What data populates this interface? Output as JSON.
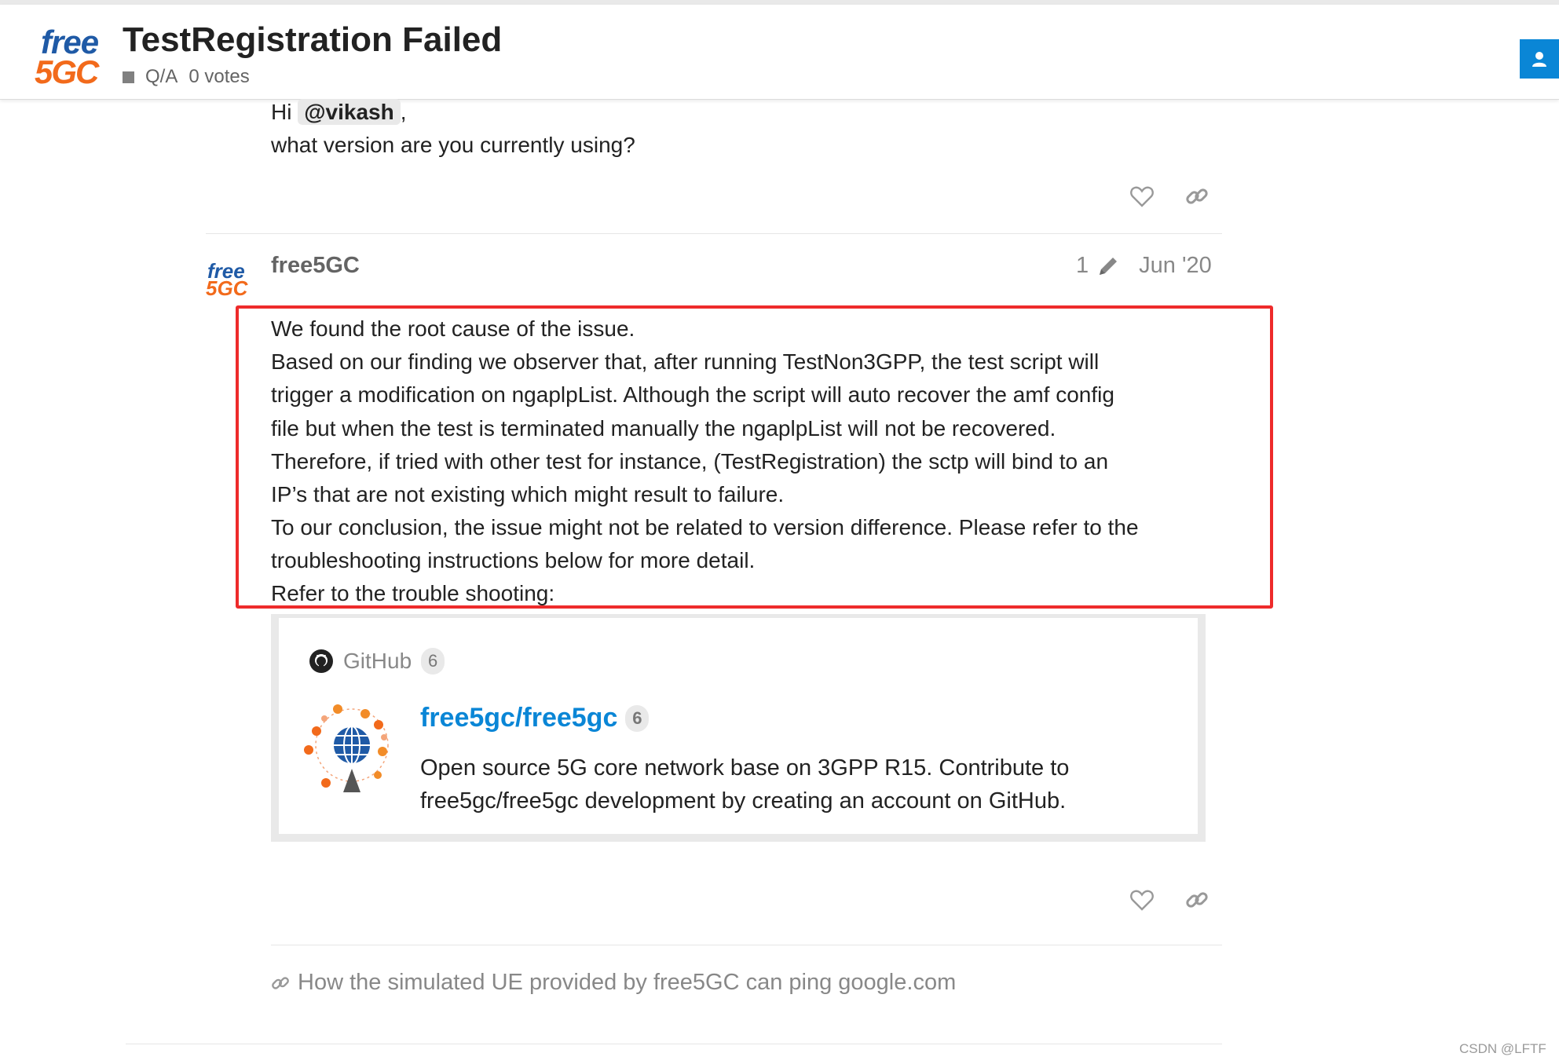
{
  "header": {
    "logo_top": "free",
    "logo_bottom": "5GC",
    "title": "TestRegistration Failed",
    "category": "Q/A",
    "votes": "0 votes"
  },
  "reply_post": {
    "greeting": "Hi",
    "mention": "@vikash",
    "comma": ",",
    "question": "what version are you currently using?"
  },
  "main_post": {
    "avatar_top": "free",
    "avatar_bottom": "5GC",
    "username": "free5GC",
    "edit_count": "1",
    "date": "Jun '20",
    "lines": [
      "We found the root cause of the issue.",
      "Based on our finding we observer that, after running TestNon3GPP, the test script will",
      "trigger a modification on ngaplpList. Although the script will auto recover the amf config",
      "file but when the test is terminated manually the ngaplpList will not be recovered.",
      "Therefore, if tried with other test for instance, (TestRegistration) the sctp will bind to an",
      "IP’s that are not existing which might result to failure.",
      "To our conclusion, the issue might not be related to version difference. Please refer to the",
      "troubleshooting instructions below for more detail.",
      "Refer to the trouble shooting:"
    ]
  },
  "onebox": {
    "source": "GitHub",
    "source_count": "6",
    "repo": "free5gc/free5gc",
    "repo_count": "6",
    "description_line1": "Open source 5G core network base on 3GPP R15. Contribute to",
    "description_line2": "free5gc/free5gc development by creating an account on GitHub."
  },
  "linked_topic": {
    "text": "How the simulated UE provided by free5GC can ping google.com"
  },
  "watermark": "CSDN @LFTF",
  "colors": {
    "accent": "#0a86d6",
    "highlight": "#ee2b2b",
    "logo_blue": "#1f5aa6",
    "logo_orange": "#f26a1b"
  }
}
